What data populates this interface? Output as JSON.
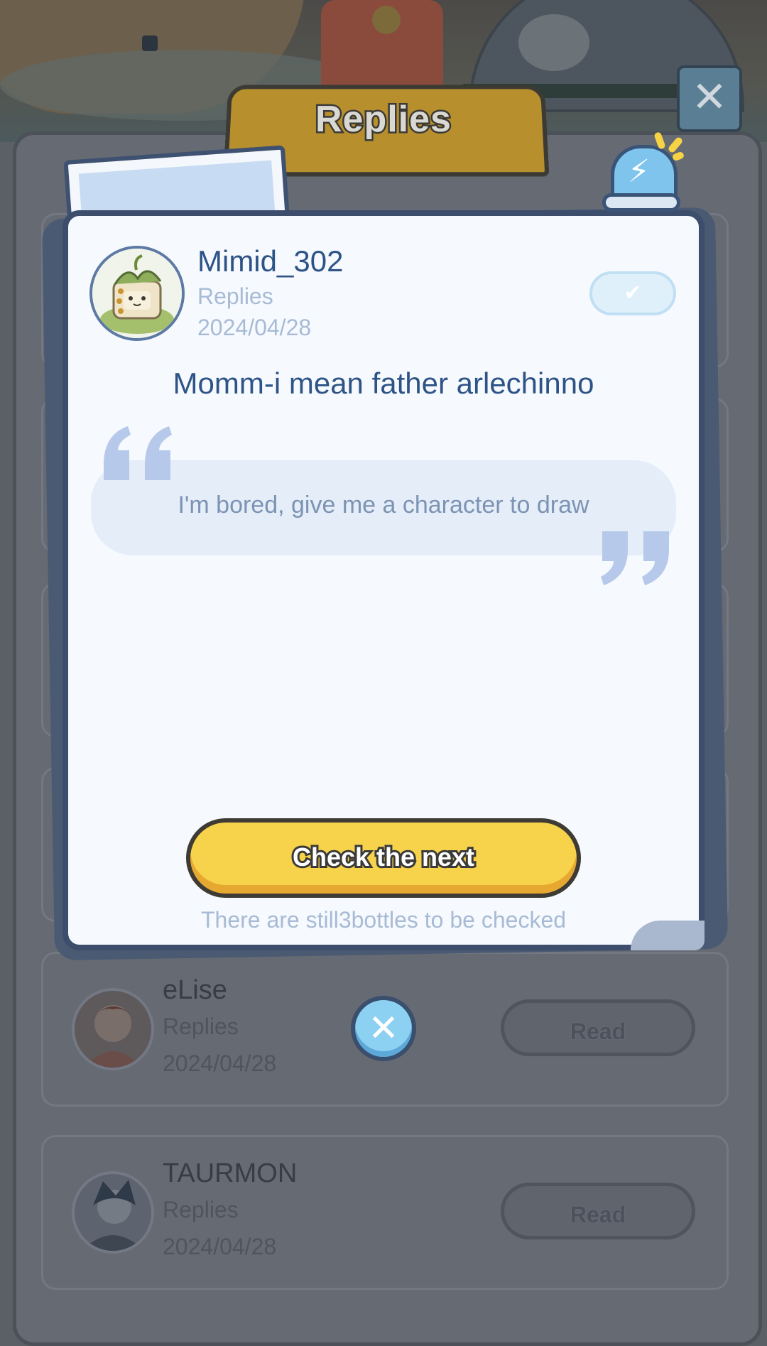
{
  "dialog": {
    "title": "Replies",
    "close_icon": "close-x-icon",
    "siren_icon": "lightning-siren-icon"
  },
  "reply": {
    "username": "Mimid_302",
    "type": "Replies",
    "date": "2024/04/28",
    "message": "Momm-i mean father arlechinno",
    "quoted_text": "I'm bored, give me a character to draw",
    "check_icon": "checkmark-icon"
  },
  "actions": {
    "next_label": "Check the next",
    "remaining_text": "There are still3bottles to be checked"
  },
  "list": {
    "items": [
      {
        "name": "eLise",
        "type": "Replies",
        "date": "2024/04/28",
        "button": "Read"
      },
      {
        "name": "TAURMON",
        "type": "Replies",
        "date": "2024/04/28",
        "button": "Read"
      }
    ]
  },
  "colors": {
    "accent_yellow": "#f7d24b",
    "title_text": "#2e5487",
    "muted_text": "#a7bbd6",
    "card_bg": "#f6f9fd",
    "outline": "#3c4e6c"
  }
}
